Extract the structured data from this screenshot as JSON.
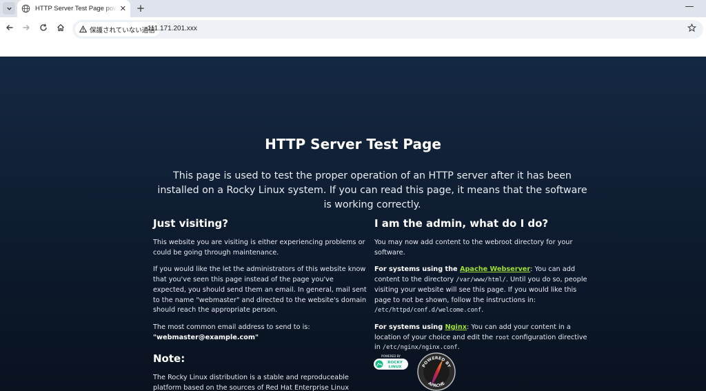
{
  "browser": {
    "tab_title": "HTTP Server Test Page powered by Rocky Linux",
    "tab_list_icon": "chevron-down-icon",
    "new_tab_glyph": "+",
    "close_glyph": "✕",
    "minimize_glyph": "—",
    "security_label": "保護されていない通信",
    "url": "111.171.201.xxx",
    "colors": {
      "tabbar": "#dfe3eb",
      "omnibox": "#eef1f6"
    }
  },
  "page": {
    "title": "HTTP Server Test Page",
    "intro": "This page is used to test the proper operation of an HTTP server after it has been installed on a Rocky Linux system. If you can read this page, it means that the software is working correctly.",
    "left": {
      "heading": "Just visiting?",
      "p1": "This website you are visiting is either experiencing problems or could be going through maintenance.",
      "p2": "If you would like the let the administrators of this website know that you've seen this page instead of the page you've expected, you should send them an email. In general, mail sent to the name \"webmaster\" and directed to the website's domain should reach the appropriate person.",
      "p3": "The most common email address to send to is:",
      "email": "\"webmaster@example.com\"",
      "note_heading": "Note:",
      "note_text": "The Rocky Linux distribution is a stable and reproduceable platform based on the sources of Red Hat Enterprise Linux (RHEL)."
    },
    "right": {
      "heading": "I am the admin, what do I do?",
      "p1": "You may now add content to the webroot directory for your software.",
      "apache_prefix": "For systems using the ",
      "apache_link": "Apache Webserver",
      "apache_text1": ": You can add content to the directory ",
      "apache_dir": "/var/www/html/",
      "apache_text2": ". Until you do so, people visiting your website will see this page. If you would like this page to not be shown, follow the instructions in: ",
      "apache_conf": "/etc/httpd/conf.d/welcome.conf",
      "apache_end": ".",
      "nginx_prefix": "For systems using ",
      "nginx_link": "Nginx",
      "nginx_text1": ": You can add your content in a location of your choice and edit the ",
      "nginx_root": "root",
      "nginx_text2": " configuration directive in ",
      "nginx_conf": "/etc/nginx/nginx.conf",
      "nginx_end": "."
    },
    "logos": {
      "rocky_powered": "POWERED BY",
      "rocky_name_1": "ROCKY",
      "rocky_name_2": "LINUX",
      "apache_top": "POWERED BY",
      "apache_bottom": "APACHE"
    },
    "colors": {
      "background": "#132640",
      "link": "#9fe02f"
    }
  }
}
